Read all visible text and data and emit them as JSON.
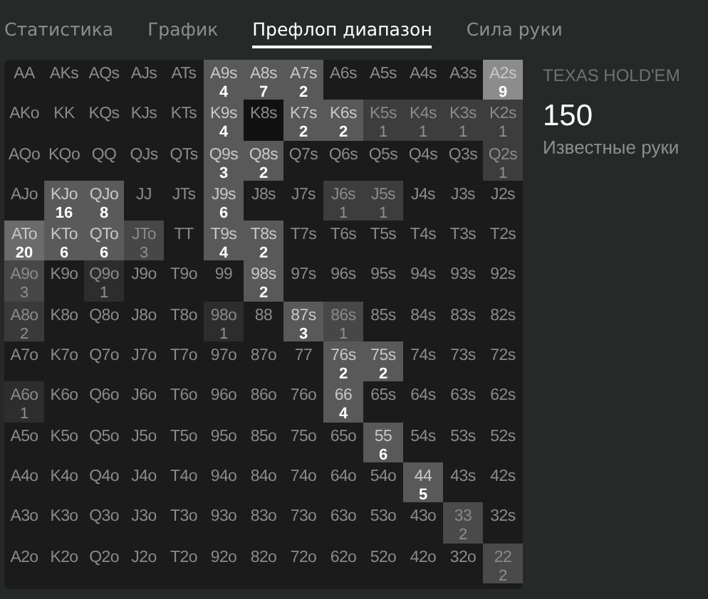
{
  "tabs": [
    {
      "label": "Статистика",
      "selected": false
    },
    {
      "label": "График",
      "selected": false
    },
    {
      "label": "Префлоп диапазон",
      "selected": true
    },
    {
      "label": "Сила руки",
      "selected": false
    }
  ],
  "range_grid": {
    "rows": [
      [
        {
          "hand": "AA"
        },
        {
          "hand": "AKs"
        },
        {
          "hand": "AQs"
        },
        {
          "hand": "AJs"
        },
        {
          "hand": "ATs"
        },
        {
          "hand": "A9s",
          "count": "4",
          "color": "#595959"
        },
        {
          "hand": "A8s",
          "count": "7",
          "color": "#595959"
        },
        {
          "hand": "A7s",
          "count": "2",
          "color": "#595959"
        },
        {
          "hand": "A6s"
        },
        {
          "hand": "A5s"
        },
        {
          "hand": "A4s"
        },
        {
          "hand": "A3s"
        },
        {
          "hand": "A2s",
          "count": "9",
          "color": "#8c8c8c"
        }
      ],
      [
        {
          "hand": "AKo"
        },
        {
          "hand": "KK"
        },
        {
          "hand": "KQs"
        },
        {
          "hand": "KJs"
        },
        {
          "hand": "KTs"
        },
        {
          "hand": "K9s",
          "count": "4",
          "color": "#595959"
        },
        {
          "hand": "K8s",
          "color": "#111111"
        },
        {
          "hand": "K7s",
          "count": "2",
          "color": "#595959"
        },
        {
          "hand": "K6s",
          "count": "2",
          "color": "#595959"
        },
        {
          "hand": "K5s",
          "count": "1",
          "color": "#3d3d3d"
        },
        {
          "hand": "K4s",
          "count": "1",
          "color": "#3d3d3d"
        },
        {
          "hand": "K3s",
          "count": "1",
          "color": "#3d3d3d"
        },
        {
          "hand": "K2s",
          "count": "1",
          "color": "#3d3d3d"
        }
      ],
      [
        {
          "hand": "AQo"
        },
        {
          "hand": "KQo"
        },
        {
          "hand": "QQ"
        },
        {
          "hand": "QJs"
        },
        {
          "hand": "QTs"
        },
        {
          "hand": "Q9s",
          "count": "3",
          "color": "#595959"
        },
        {
          "hand": "Q8s",
          "count": "2",
          "color": "#595959"
        },
        {
          "hand": "Q7s"
        },
        {
          "hand": "Q6s"
        },
        {
          "hand": "Q5s"
        },
        {
          "hand": "Q4s"
        },
        {
          "hand": "Q3s"
        },
        {
          "hand": "Q2s",
          "count": "1",
          "color": "#3d3d3d"
        }
      ],
      [
        {
          "hand": "AJo"
        },
        {
          "hand": "KJo",
          "count": "16",
          "color": "#5a5a5a"
        },
        {
          "hand": "QJo",
          "count": "8",
          "color": "#5a5a5a"
        },
        {
          "hand": "JJ"
        },
        {
          "hand": "JTs"
        },
        {
          "hand": "J9s",
          "count": "6",
          "color": "#595959"
        },
        {
          "hand": "J8s"
        },
        {
          "hand": "J7s"
        },
        {
          "hand": "J6s",
          "count": "1",
          "color": "#3d3d3d"
        },
        {
          "hand": "J5s",
          "count": "1",
          "color": "#3d3d3d"
        },
        {
          "hand": "J4s"
        },
        {
          "hand": "J3s"
        },
        {
          "hand": "J2s"
        }
      ],
      [
        {
          "hand": "ATo",
          "count": "20",
          "color": "#6b6b6b"
        },
        {
          "hand": "KTo",
          "count": "6",
          "color": "#5a5a5a"
        },
        {
          "hand": "QTo",
          "count": "6",
          "color": "#5a5a5a"
        },
        {
          "hand": "JTo",
          "count": "3",
          "color": "#474747"
        },
        {
          "hand": "TT"
        },
        {
          "hand": "T9s",
          "count": "4",
          "color": "#595959"
        },
        {
          "hand": "T8s",
          "count": "2",
          "color": "#595959"
        },
        {
          "hand": "T7s"
        },
        {
          "hand": "T6s"
        },
        {
          "hand": "T5s"
        },
        {
          "hand": "T4s"
        },
        {
          "hand": "T3s"
        },
        {
          "hand": "T2s"
        }
      ],
      [
        {
          "hand": "A9o",
          "count": "3",
          "color": "#474747"
        },
        {
          "hand": "K9o"
        },
        {
          "hand": "Q9o",
          "count": "1",
          "color": "#2d2d2d"
        },
        {
          "hand": "J9o"
        },
        {
          "hand": "T9o"
        },
        {
          "hand": "99"
        },
        {
          "hand": "98s",
          "count": "2",
          "color": "#595959"
        },
        {
          "hand": "97s"
        },
        {
          "hand": "96s"
        },
        {
          "hand": "95s"
        },
        {
          "hand": "94s"
        },
        {
          "hand": "93s"
        },
        {
          "hand": "92s"
        }
      ],
      [
        {
          "hand": "A8o",
          "count": "2",
          "color": "#3a3a3a"
        },
        {
          "hand": "K8o"
        },
        {
          "hand": "Q8o"
        },
        {
          "hand": "J8o"
        },
        {
          "hand": "T8o"
        },
        {
          "hand": "98o",
          "count": "1",
          "color": "#2d2d2d"
        },
        {
          "hand": "88"
        },
        {
          "hand": "87s",
          "count": "3",
          "color": "#595959"
        },
        {
          "hand": "86s",
          "count": "1",
          "color": "#474747"
        },
        {
          "hand": "85s"
        },
        {
          "hand": "84s"
        },
        {
          "hand": "83s"
        },
        {
          "hand": "82s"
        }
      ],
      [
        {
          "hand": "A7o"
        },
        {
          "hand": "K7o"
        },
        {
          "hand": "Q7o"
        },
        {
          "hand": "J7o"
        },
        {
          "hand": "T7o"
        },
        {
          "hand": "97o"
        },
        {
          "hand": "87o"
        },
        {
          "hand": "77"
        },
        {
          "hand": "76s",
          "count": "2",
          "color": "#595959"
        },
        {
          "hand": "75s",
          "count": "2",
          "color": "#595959"
        },
        {
          "hand": "74s"
        },
        {
          "hand": "73s"
        },
        {
          "hand": "72s"
        }
      ],
      [
        {
          "hand": "A6o",
          "count": "1",
          "color": "#2d2d2d"
        },
        {
          "hand": "K6o"
        },
        {
          "hand": "Q6o"
        },
        {
          "hand": "J6o"
        },
        {
          "hand": "T6o"
        },
        {
          "hand": "96o"
        },
        {
          "hand": "86o"
        },
        {
          "hand": "76o"
        },
        {
          "hand": "66",
          "count": "4",
          "color": "#595959"
        },
        {
          "hand": "65s"
        },
        {
          "hand": "64s"
        },
        {
          "hand": "63s"
        },
        {
          "hand": "62s"
        }
      ],
      [
        {
          "hand": "A5o"
        },
        {
          "hand": "K5o"
        },
        {
          "hand": "Q5o"
        },
        {
          "hand": "J5o"
        },
        {
          "hand": "T5o"
        },
        {
          "hand": "95o"
        },
        {
          "hand": "85o"
        },
        {
          "hand": "75o"
        },
        {
          "hand": "65o"
        },
        {
          "hand": "55",
          "count": "6",
          "color": "#595959"
        },
        {
          "hand": "54s"
        },
        {
          "hand": "53s"
        },
        {
          "hand": "52s"
        }
      ],
      [
        {
          "hand": "A4o"
        },
        {
          "hand": "K4o"
        },
        {
          "hand": "Q4o"
        },
        {
          "hand": "J4o"
        },
        {
          "hand": "T4o"
        },
        {
          "hand": "94o"
        },
        {
          "hand": "84o"
        },
        {
          "hand": "74o"
        },
        {
          "hand": "64o"
        },
        {
          "hand": "54o"
        },
        {
          "hand": "44",
          "count": "5",
          "color": "#595959"
        },
        {
          "hand": "43s"
        },
        {
          "hand": "42s"
        }
      ],
      [
        {
          "hand": "A3o"
        },
        {
          "hand": "K3o"
        },
        {
          "hand": "Q3o"
        },
        {
          "hand": "J3o"
        },
        {
          "hand": "T3o"
        },
        {
          "hand": "93o"
        },
        {
          "hand": "83o"
        },
        {
          "hand": "73o"
        },
        {
          "hand": "63o"
        },
        {
          "hand": "53o"
        },
        {
          "hand": "43o"
        },
        {
          "hand": "33",
          "count": "2",
          "color": "#4a4a4a"
        },
        {
          "hand": "32s"
        }
      ],
      [
        {
          "hand": "A2o"
        },
        {
          "hand": "K2o"
        },
        {
          "hand": "Q2o"
        },
        {
          "hand": "J2o"
        },
        {
          "hand": "T2o"
        },
        {
          "hand": "92o"
        },
        {
          "hand": "82o"
        },
        {
          "hand": "72o"
        },
        {
          "hand": "62o"
        },
        {
          "hand": "52o"
        },
        {
          "hand": "42o"
        },
        {
          "hand": "32o"
        },
        {
          "hand": "22",
          "count": "2",
          "color": "#4a4a4a"
        }
      ]
    ]
  },
  "info": {
    "game": "TEXAS HOLD'EM",
    "total": "150",
    "total_label": "Известные руки"
  }
}
